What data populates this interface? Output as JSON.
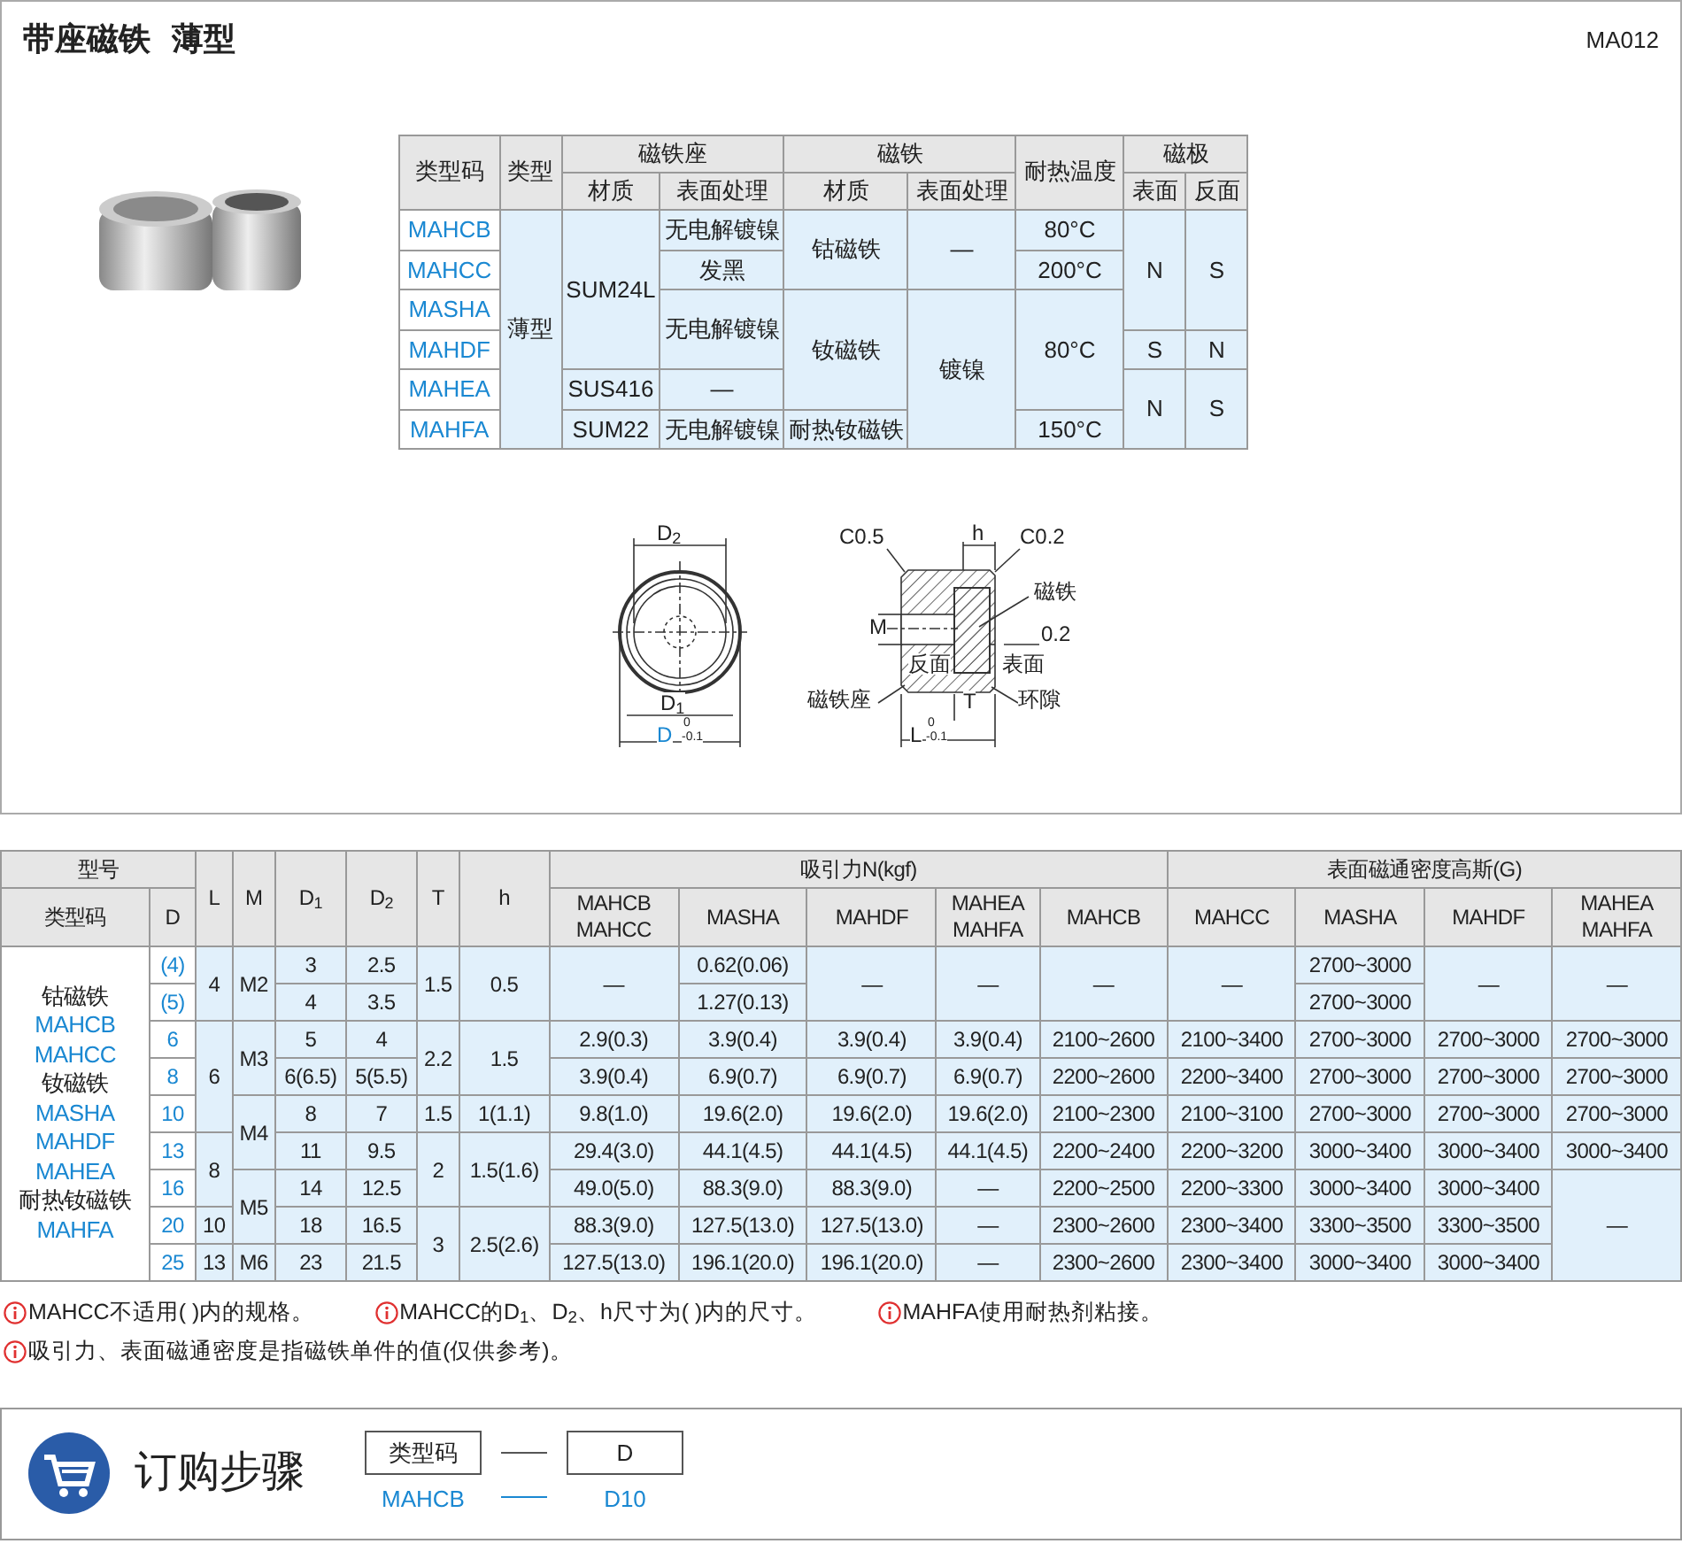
{
  "header": {
    "title": [
      "带座磁铁",
      "薄型"
    ],
    "code": "MA012"
  },
  "spec_table": {
    "rows": [
      [
        {
          "text": "类型码",
          "kind": "head",
          "rowspan": 2
        },
        {
          "text": "类型",
          "kind": "head",
          "rowspan": 2
        },
        {
          "text": "磁铁座",
          "kind": "head",
          "colspan": 2
        },
        {
          "text": "磁铁",
          "kind": "head",
          "colspan": 2
        },
        {
          "text": "耐热温度",
          "kind": "head",
          "rowspan": 2
        },
        {
          "text": "磁极",
          "kind": "head",
          "colspan": 2
        }
      ],
      [
        {
          "text": "材质",
          "kind": "head"
        },
        {
          "text": "表面处理",
          "kind": "head"
        },
        {
          "text": "材质",
          "kind": "head"
        },
        {
          "text": "表面处理",
          "kind": "head"
        },
        {
          "text": "表面",
          "kind": "head"
        },
        {
          "text": "反面",
          "kind": "head"
        }
      ],
      [
        {
          "text": "MAHCB",
          "kind": "code"
        },
        {
          "text": "薄型",
          "kind": "value",
          "rowspan": 6
        },
        {
          "text": "SUM24L",
          "kind": "value",
          "rowspan": 4
        },
        {
          "text": "无电解镀镍",
          "kind": "value"
        },
        {
          "text": "钴磁铁",
          "kind": "value",
          "rowspan": 2
        },
        {
          "text": "—",
          "kind": "value",
          "rowspan": 2
        },
        {
          "text": "80°C",
          "kind": "value"
        },
        {
          "text": "N",
          "kind": "value",
          "rowspan": 3
        },
        {
          "text": "S",
          "kind": "value",
          "rowspan": 3
        }
      ],
      [
        {
          "text": "MAHCC",
          "kind": "code"
        },
        {
          "text": "发黑",
          "kind": "value"
        },
        {
          "text": "200°C",
          "kind": "value"
        }
      ],
      [
        {
          "text": "MASHA",
          "kind": "code"
        },
        {
          "text": "无电解镀镍",
          "kind": "value",
          "rowspan": 2
        },
        {
          "text": "钕磁铁",
          "kind": "value",
          "rowspan": 3
        },
        {
          "text": "镀镍",
          "kind": "value",
          "rowspan": 4
        },
        {
          "text": "80°C",
          "kind": "value",
          "rowspan": 3
        }
      ],
      [
        {
          "text": "MAHDF",
          "kind": "code"
        },
        {
          "text": "S",
          "kind": "value"
        },
        {
          "text": "N",
          "kind": "value"
        }
      ],
      [
        {
          "text": "MAHEA",
          "kind": "code"
        },
        {
          "text": "SUS416",
          "kind": "value"
        },
        {
          "text": "—",
          "kind": "value"
        },
        {
          "text": "N",
          "kind": "value",
          "rowspan": 2
        },
        {
          "text": "S",
          "kind": "value",
          "rowspan": 2
        }
      ],
      [
        {
          "text": "MAHFA",
          "kind": "code"
        },
        {
          "text": "SUM22",
          "kind": "value"
        },
        {
          "text": "无电解镀镍",
          "kind": "value"
        },
        {
          "text": "耐热钕磁铁",
          "kind": "value"
        },
        {
          "text": "150°C",
          "kind": "value"
        }
      ]
    ]
  },
  "dimension_drawing": {
    "labels": [
      {
        "text": "D$_{2}$",
        "kind": "dim"
      },
      {
        "text": "D$_{1}$",
        "kind": "dim"
      },
      {
        "text": "D",
        "kind": "highlight"
      },
      {
        "text": "0",
        "kind": "tol"
      },
      {
        "text": "-0.1",
        "kind": "tol"
      },
      {
        "text": "C0.5",
        "kind": "dim"
      },
      {
        "text": "h",
        "kind": "dim"
      },
      {
        "text": "C0.2",
        "kind": "dim"
      },
      {
        "text": "磁铁",
        "kind": "dim"
      },
      {
        "text": "0.2",
        "kind": "dim"
      },
      {
        "text": "M",
        "kind": "dim"
      },
      {
        "text": "反面",
        "kind": "dim"
      },
      {
        "text": "表面",
        "kind": "dim"
      },
      {
        "text": "磁铁座",
        "kind": "dim"
      },
      {
        "text": "T",
        "kind": "dim"
      },
      {
        "text": "环隙",
        "kind": "dim"
      },
      {
        "text": "L",
        "kind": "dim"
      },
      {
        "text": "0",
        "kind": "tol"
      },
      {
        "text": "-0.1",
        "kind": "tol"
      }
    ]
  },
  "size_table": {
    "rows": [
      [
        {
          "text": "型号",
          "kind": "head",
          "colspan": 2
        },
        {
          "text": "L",
          "kind": "head",
          "rowspan": 2
        },
        {
          "text": "M",
          "kind": "head",
          "rowspan": 2
        },
        {
          "text": "D$_{1}$",
          "kind": "head",
          "rowspan": 2
        },
        {
          "text": "D$_{2}$",
          "kind": "head",
          "rowspan": 2
        },
        {
          "text": "T",
          "kind": "head",
          "rowspan": 2
        },
        {
          "text": "h",
          "kind": "head",
          "rowspan": 2
        },
        {
          "text": "吸引力N(kgf)",
          "kind": "head",
          "colspan": 5
        },
        {
          "text": "表面磁通密度高斯(G)",
          "kind": "head",
          "colspan": 5
        }
      ],
      [
        {
          "text": "类型码",
          "kind": "head"
        },
        {
          "text": "D",
          "kind": "head"
        },
        {
          "text": "MAHCB\nMAHCC",
          "kind": "head"
        },
        {
          "text": "MASHA",
          "kind": "head"
        },
        {
          "text": "MAHDF",
          "kind": "head"
        },
        {
          "text": "MAHEA\nMAHFA",
          "kind": "head"
        },
        {
          "text": "MAHCB",
          "kind": "head"
        },
        {
          "text": "MAHCC",
          "kind": "head"
        },
        {
          "text": "MASHA",
          "kind": "head"
        },
        {
          "text": "MAHDF",
          "kind": "head"
        },
        {
          "text": "MAHEA\nMAHFA",
          "kind": "head"
        }
      ],
      [
        {
          "kind": "group",
          "rowspan": 9,
          "lines": [
            {
              "text": "钴磁铁",
              "kind": "label"
            },
            {
              "text": "MAHCB",
              "kind": "code"
            },
            {
              "text": "MAHCC",
              "kind": "code"
            },
            {
              "text": "钕磁铁",
              "kind": "label"
            },
            {
              "text": "MASHA",
              "kind": "code"
            },
            {
              "text": "MAHDF",
              "kind": "code"
            },
            {
              "text": "MAHEA",
              "kind": "code"
            },
            {
              "text": "耐热钕磁铁",
              "kind": "label"
            },
            {
              "text": "MAHFA",
              "kind": "code"
            }
          ]
        },
        {
          "text": "(4)",
          "kind": "code"
        },
        {
          "text": "4",
          "kind": "value",
          "rowspan": 2
        },
        {
          "text": "M2",
          "kind": "value",
          "rowspan": 2
        },
        {
          "text": "3",
          "kind": "value"
        },
        {
          "text": "2.5",
          "kind": "value"
        },
        {
          "text": "1.5",
          "kind": "value",
          "rowspan": 2
        },
        {
          "text": "0.5",
          "kind": "value",
          "rowspan": 2
        },
        {
          "text": "—",
          "kind": "value",
          "rowspan": 2
        },
        {
          "text": "0.62(0.06)",
          "kind": "value"
        },
        {
          "text": "—",
          "kind": "value",
          "rowspan": 2
        },
        {
          "text": "—",
          "kind": "value",
          "rowspan": 2
        },
        {
          "text": "—",
          "kind": "value",
          "rowspan": 2
        },
        {
          "text": "—",
          "kind": "value",
          "rowspan": 2
        },
        {
          "text": "2700~3000",
          "kind": "value"
        },
        {
          "text": "—",
          "kind": "value",
          "rowspan": 2
        },
        {
          "text": "—",
          "kind": "value",
          "rowspan": 2
        }
      ],
      [
        {
          "text": "(5)",
          "kind": "code"
        },
        {
          "text": "4",
          "kind": "value"
        },
        {
          "text": "3.5",
          "kind": "value"
        },
        {
          "text": "1.27(0.13)",
          "kind": "value"
        },
        {
          "text": "2700~3000",
          "kind": "value"
        }
      ],
      [
        {
          "text": "6",
          "kind": "code"
        },
        {
          "text": "6",
          "kind": "value",
          "rowspan": 3
        },
        {
          "text": "M3",
          "kind": "value",
          "rowspan": 2
        },
        {
          "text": "5",
          "kind": "value"
        },
        {
          "text": "4",
          "kind": "value"
        },
        {
          "text": "2.2",
          "kind": "value",
          "rowspan": 2
        },
        {
          "text": "1.5",
          "kind": "value",
          "rowspan": 2
        },
        {
          "text": "2.9(0.3)",
          "kind": "value"
        },
        {
          "text": "3.9(0.4)",
          "kind": "value"
        },
        {
          "text": "3.9(0.4)",
          "kind": "value"
        },
        {
          "text": "3.9(0.4)",
          "kind": "value"
        },
        {
          "text": "2100~2600",
          "kind": "value"
        },
        {
          "text": "2100~3400",
          "kind": "value"
        },
        {
          "text": "2700~3000",
          "kind": "value"
        },
        {
          "text": "2700~3000",
          "kind": "value"
        },
        {
          "text": "2700~3000",
          "kind": "value"
        }
      ],
      [
        {
          "text": "8",
          "kind": "code"
        },
        {
          "text": "6(6.5)",
          "kind": "value"
        },
        {
          "text": "5(5.5)",
          "kind": "value"
        },
        {
          "text": "3.9(0.4)",
          "kind": "value"
        },
        {
          "text": "6.9(0.7)",
          "kind": "value"
        },
        {
          "text": "6.9(0.7)",
          "kind": "value"
        },
        {
          "text": "6.9(0.7)",
          "kind": "value"
        },
        {
          "text": "2200~2600",
          "kind": "value"
        },
        {
          "text": "2200~3400",
          "kind": "value"
        },
        {
          "text": "2700~3000",
          "kind": "value"
        },
        {
          "text": "2700~3000",
          "kind": "value"
        },
        {
          "text": "2700~3000",
          "kind": "value"
        }
      ],
      [
        {
          "text": "10",
          "kind": "code"
        },
        {
          "text": "M4",
          "kind": "value",
          "rowspan": 2
        },
        {
          "text": "8",
          "kind": "value"
        },
        {
          "text": "7",
          "kind": "value"
        },
        {
          "text": "1.5",
          "kind": "value"
        },
        {
          "text": "1(1.1)",
          "kind": "value"
        },
        {
          "text": "9.8(1.0)",
          "kind": "value"
        },
        {
          "text": "19.6(2.0)",
          "kind": "value"
        },
        {
          "text": "19.6(2.0)",
          "kind": "value"
        },
        {
          "text": "19.6(2.0)",
          "kind": "value"
        },
        {
          "text": "2100~2300",
          "kind": "value"
        },
        {
          "text": "2100~3100",
          "kind": "value"
        },
        {
          "text": "2700~3000",
          "kind": "value"
        },
        {
          "text": "2700~3000",
          "kind": "value"
        },
        {
          "text": "2700~3000",
          "kind": "value"
        }
      ],
      [
        {
          "text": "13",
          "kind": "code"
        },
        {
          "text": "8",
          "kind": "value",
          "rowspan": 2
        },
        {
          "text": "11",
          "kind": "value"
        },
        {
          "text": "9.5",
          "kind": "value"
        },
        {
          "text": "2",
          "kind": "value",
          "rowspan": 2
        },
        {
          "text": "1.5(1.6)",
          "kind": "value",
          "rowspan": 2
        },
        {
          "text": "29.4(3.0)",
          "kind": "value"
        },
        {
          "text": "44.1(4.5)",
          "kind": "value"
        },
        {
          "text": "44.1(4.5)",
          "kind": "value"
        },
        {
          "text": "44.1(4.5)",
          "kind": "value"
        },
        {
          "text": "2200~2400",
          "kind": "value"
        },
        {
          "text": "2200~3200",
          "kind": "value"
        },
        {
          "text": "3000~3400",
          "kind": "value"
        },
        {
          "text": "3000~3400",
          "kind": "value"
        },
        {
          "text": "3000~3400",
          "kind": "value"
        }
      ],
      [
        {
          "text": "16",
          "kind": "code"
        },
        {
          "text": "M5",
          "kind": "value",
          "rowspan": 2
        },
        {
          "text": "14",
          "kind": "value"
        },
        {
          "text": "12.5",
          "kind": "value"
        },
        {
          "text": "49.0(5.0)",
          "kind": "value"
        },
        {
          "text": "88.3(9.0)",
          "kind": "value"
        },
        {
          "text": "88.3(9.0)",
          "kind": "value"
        },
        {
          "text": "—",
          "kind": "value"
        },
        {
          "text": "2200~2500",
          "kind": "value"
        },
        {
          "text": "2200~3300",
          "kind": "value"
        },
        {
          "text": "3000~3400",
          "kind": "value"
        },
        {
          "text": "3000~3400",
          "kind": "value"
        },
        {
          "text": "—",
          "kind": "value",
          "rowspan": 3
        }
      ],
      [
        {
          "text": "20",
          "kind": "code"
        },
        {
          "text": "10",
          "kind": "value"
        },
        {
          "text": "18",
          "kind": "value"
        },
        {
          "text": "16.5",
          "kind": "value"
        },
        {
          "text": "3",
          "kind": "value",
          "rowspan": 2
        },
        {
          "text": "2.5(2.6)",
          "kind": "value",
          "rowspan": 2
        },
        {
          "text": "88.3(9.0)",
          "kind": "value"
        },
        {
          "text": "127.5(13.0)",
          "kind": "value"
        },
        {
          "text": "127.5(13.0)",
          "kind": "value"
        },
        {
          "text": "—",
          "kind": "value"
        },
        {
          "text": "2300~2600",
          "kind": "value"
        },
        {
          "text": "2300~3400",
          "kind": "value"
        },
        {
          "text": "3300~3500",
          "kind": "value"
        },
        {
          "text": "3300~3500",
          "kind": "value"
        }
      ],
      [
        {
          "text": "25",
          "kind": "code"
        },
        {
          "text": "13",
          "kind": "value"
        },
        {
          "text": "M6",
          "kind": "value"
        },
        {
          "text": "23",
          "kind": "value"
        },
        {
          "text": "21.5",
          "kind": "value"
        },
        {
          "text": "127.5(13.0)",
          "kind": "value"
        },
        {
          "text": "196.1(20.0)",
          "kind": "value"
        },
        {
          "text": "196.1(20.0)",
          "kind": "value"
        },
        {
          "text": "—",
          "kind": "value"
        },
        {
          "text": "2300~2600",
          "kind": "value"
        },
        {
          "text": "2300~3400",
          "kind": "value"
        },
        {
          "text": "3000~3400",
          "kind": "value"
        },
        {
          "text": "3000~3400",
          "kind": "value"
        }
      ]
    ]
  },
  "notes": [
    [
      "MAHCC不适用( )内的规格。",
      "MAHCC的D$_{1}$、D$_{2}$、h尺寸为( )内的尺寸。",
      "MAHFA使用耐热剂粘接。"
    ],
    [
      "吸引力、表面磁通密度是指磁铁单件的值(仅供参考)。"
    ]
  ],
  "ordering": {
    "title": "订购步骤",
    "fields": [
      {
        "label": "类型码",
        "example": "MAHCB"
      },
      {
        "label": "D",
        "example": "D10"
      }
    ]
  }
}
